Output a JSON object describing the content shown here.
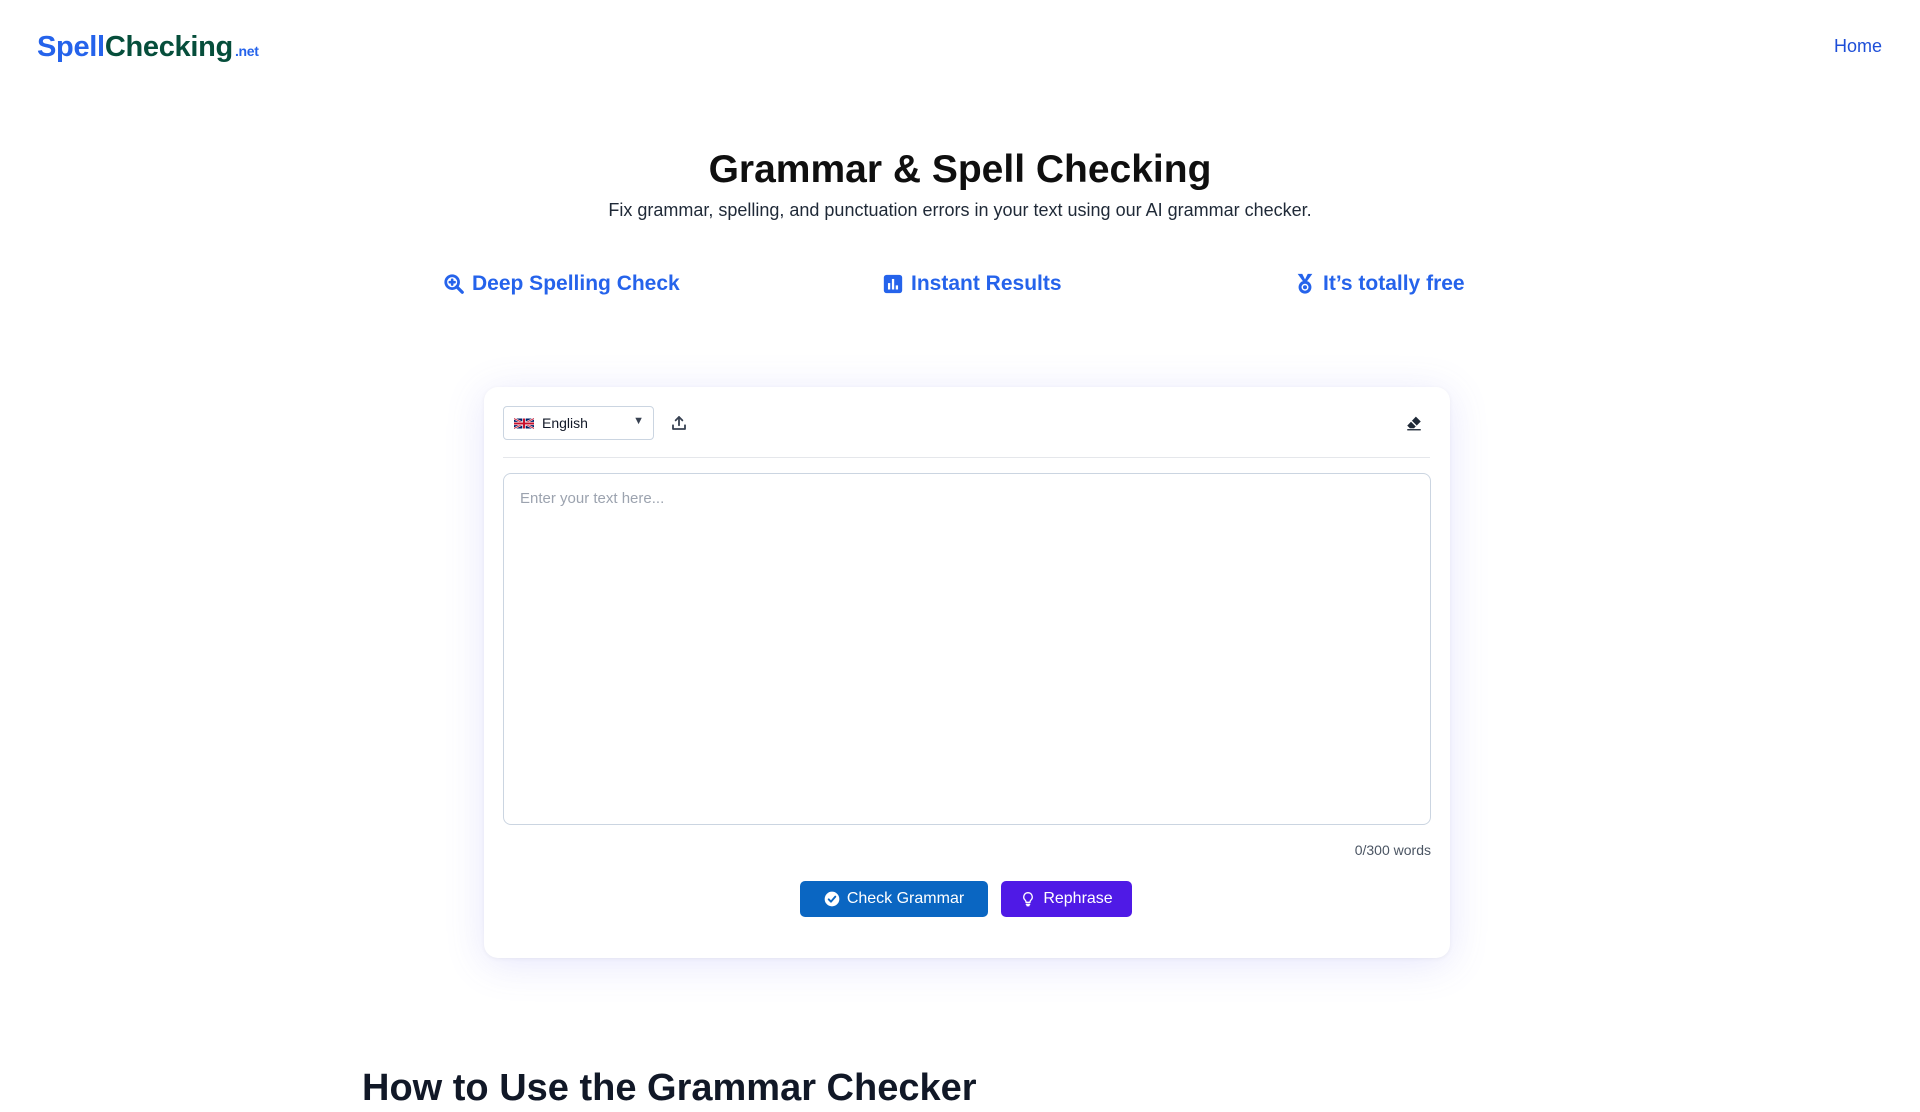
{
  "header": {
    "logo": {
      "part1": "Spell",
      "part2": "Checking",
      "part3": ".net"
    },
    "nav": {
      "home_label": "Home"
    }
  },
  "hero": {
    "title": "Grammar & Spell Checking",
    "subtitle": "Fix grammar, spelling, and punctuation errors in your text using our AI grammar checker."
  },
  "features": [
    {
      "label": "Deep Spelling Check",
      "icon": "search-zoom-icon"
    },
    {
      "label": "Instant Results",
      "icon": "bar-chart-icon"
    },
    {
      "label": "It’s totally free",
      "icon": "medal-icon"
    }
  ],
  "editor": {
    "language": {
      "selected": "English",
      "flag_icon": "uk-flag-icon"
    },
    "upload_icon": "upload-icon",
    "clear_icon": "eraser-icon",
    "text": {
      "value": "",
      "placeholder": "Enter your text here..."
    },
    "word_count": "0/300 words",
    "buttons": {
      "check_label": "Check Grammar",
      "rephrase_label": "Rephrase"
    }
  },
  "section": {
    "heading": "How to Use the Grammar Checker"
  },
  "colors": {
    "brand_blue": "#2563eb",
    "logo_green": "#064e3b",
    "check_button": "#0a66c2",
    "rephrase_button": "#4f1ae6"
  }
}
